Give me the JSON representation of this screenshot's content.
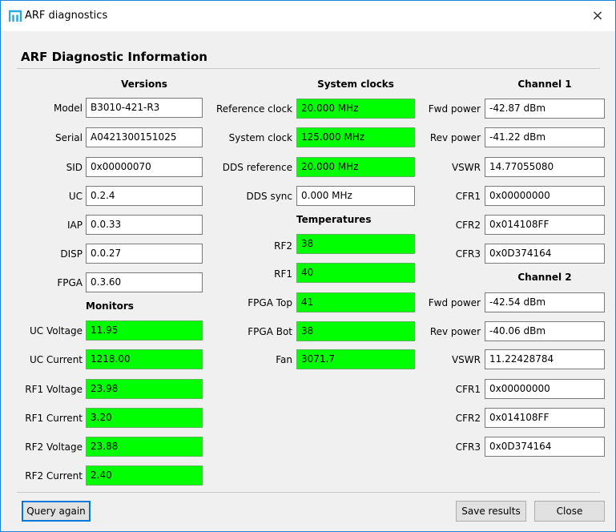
{
  "window": {
    "title": "ARF diagnostics",
    "close_glyph": "×"
  },
  "heading": "ARF Diagnostic Information",
  "versions": {
    "title": "Versions",
    "rows": [
      {
        "label": "Model",
        "value": "B3010-421-R3"
      },
      {
        "label": "Serial",
        "value": "A0421300151025"
      },
      {
        "label": "SID",
        "value": "0x00000070"
      },
      {
        "label": "UC",
        "value": "0.2.4"
      },
      {
        "label": "IAP",
        "value": "0.0.33"
      },
      {
        "label": "DISP",
        "value": "0.0.27"
      },
      {
        "label": "FPGA",
        "value": "0.3.60"
      }
    ]
  },
  "monitors": {
    "title": "Monitors",
    "rows": [
      {
        "label": "UC Voltage",
        "value": "11.95"
      },
      {
        "label": "UC Current",
        "value": "1218.00"
      },
      {
        "label": "RF1 Voltage",
        "value": "23.98"
      },
      {
        "label": "RF1 Current",
        "value": "3.20"
      },
      {
        "label": "RF2 Voltage",
        "value": "23.88"
      },
      {
        "label": "RF2 Current",
        "value": "2.40"
      }
    ]
  },
  "system_clocks": {
    "title": "System clocks",
    "rows": [
      {
        "label": "Reference clock",
        "value": "20.000 MHz",
        "ok": true
      },
      {
        "label": "System clock",
        "value": "125.000 MHz",
        "ok": true
      },
      {
        "label": "DDS reference",
        "value": "20.000 MHz",
        "ok": true
      },
      {
        "label": "DDS sync",
        "value": "0.000 MHz",
        "ok": false
      }
    ]
  },
  "temperatures": {
    "title": "Temperatures",
    "rows": [
      {
        "label": "RF2",
        "value": "38"
      },
      {
        "label": "RF1",
        "value": "40"
      },
      {
        "label": "FPGA Top",
        "value": "41"
      },
      {
        "label": "FPGA Bot",
        "value": "38"
      },
      {
        "label": "Fan",
        "value": "3071.7"
      }
    ]
  },
  "channel1": {
    "title": "Channel 1",
    "rows": [
      {
        "label": "Fwd power",
        "value": "-42.87 dBm"
      },
      {
        "label": "Rev power",
        "value": "-41.22 dBm"
      },
      {
        "label": "VSWR",
        "value": "14.77055080"
      },
      {
        "label": "CFR1",
        "value": "0x00000000"
      },
      {
        "label": "CFR2",
        "value": "0x014108FF"
      },
      {
        "label": "CFR3",
        "value": "0x0D374164"
      }
    ]
  },
  "channel2": {
    "title": "Channel 2",
    "rows": [
      {
        "label": "Fwd power",
        "value": "-42.54 dBm"
      },
      {
        "label": "Rev power",
        "value": "-40.06 dBm"
      },
      {
        "label": "VSWR",
        "value": "11.22428784"
      },
      {
        "label": "CFR1",
        "value": "0x00000000"
      },
      {
        "label": "CFR2",
        "value": "0x014108FF"
      },
      {
        "label": "CFR3",
        "value": "0x0D374164"
      }
    ]
  },
  "buttons": {
    "query_again": "Query again",
    "save_results": "Save results",
    "close": "Close"
  },
  "colors": {
    "ok_green": "#00ff00",
    "accent_blue": "#0078d7",
    "app_icon": "#28a9e0"
  },
  "icons": {
    "app": "arf-logo-icon",
    "close": "close-icon"
  }
}
